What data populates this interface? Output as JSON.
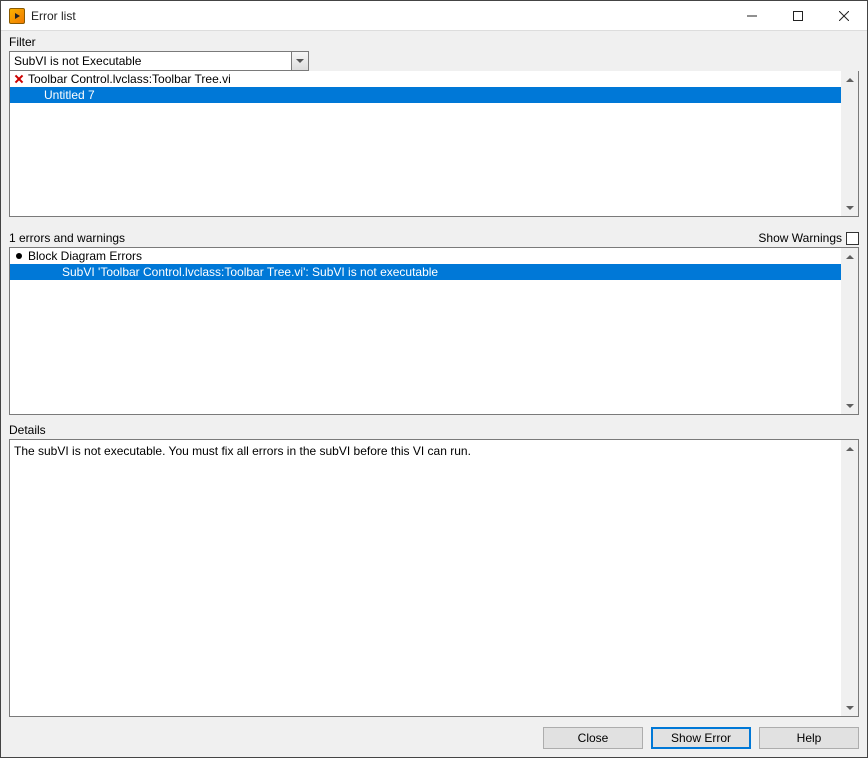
{
  "window": {
    "title": "Error list"
  },
  "filter": {
    "label": "Filter",
    "value": "SubVI is not Executable"
  },
  "items_list": {
    "rows": [
      {
        "icon": "x",
        "text": "Toolbar Control.lvclass:Toolbar Tree.vi",
        "selected": false,
        "indent": 0
      },
      {
        "icon": "",
        "text": "Untitled 7",
        "selected": true,
        "indent": 1
      }
    ]
  },
  "errors_section": {
    "count_label": "1 errors and warnings",
    "show_warnings_label": "Show Warnings",
    "show_warnings_checked": false,
    "rows": [
      {
        "icon": "dot",
        "text": "Block Diagram Errors",
        "selected": false,
        "indent": 0
      },
      {
        "icon": "",
        "text": "SubVI 'Toolbar Control.lvclass:Toolbar Tree.vi': SubVI is not executable",
        "selected": true,
        "indent": 2
      }
    ]
  },
  "details": {
    "label": "Details",
    "text": "The subVI is not executable. You must fix all errors in the subVI before this VI can run."
  },
  "buttons": {
    "close": "Close",
    "show_error": "Show Error",
    "help": "Help"
  }
}
